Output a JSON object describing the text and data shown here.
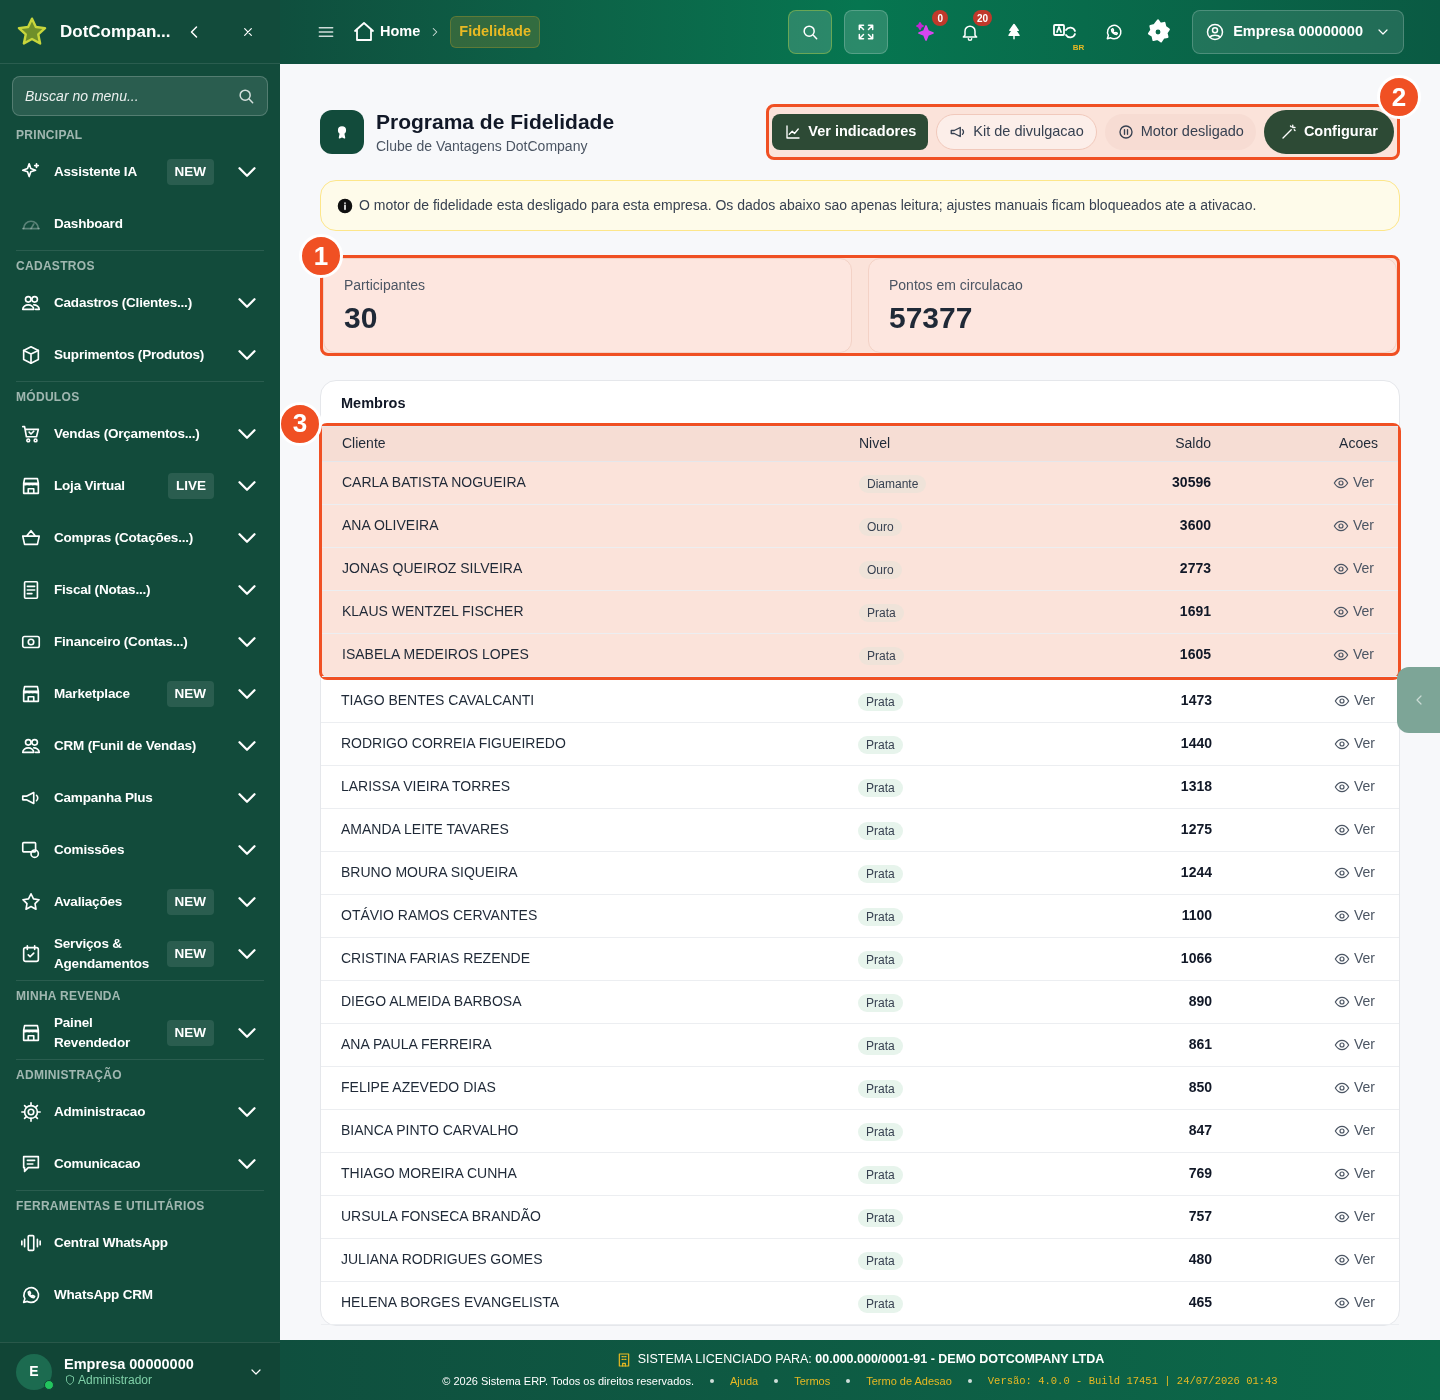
{
  "sidebar": {
    "brand": "DotCompan...",
    "search": {
      "placeholder": "Buscar no menu..."
    },
    "sections": [
      {
        "title": "PRINCIPAL",
        "items": [
          {
            "label": "Assistente IA",
            "badge": "NEW",
            "expandable": true
          },
          {
            "label": "Dashboard",
            "expandable": false
          }
        ]
      },
      {
        "title": "CADASTROS",
        "items": [
          {
            "label": "Cadastros (Clientes...)",
            "expandable": true
          },
          {
            "label": "Suprimentos (Produtos)",
            "expandable": true
          }
        ]
      },
      {
        "title": "MÓDULOS",
        "items": [
          {
            "label": "Vendas (Orçamentos...)",
            "expandable": true
          },
          {
            "label": "Loja Virtual",
            "badge": "LIVE",
            "expandable": true
          },
          {
            "label": "Compras (Cotações...)",
            "expandable": true
          },
          {
            "label": "Fiscal (Notas...)",
            "expandable": true
          },
          {
            "label": "Financeiro (Contas...)",
            "expandable": true
          },
          {
            "label": "Marketplace",
            "badge": "NEW",
            "expandable": true
          },
          {
            "label": "CRM (Funil de Vendas)",
            "expandable": true
          },
          {
            "label": "Campanha Plus",
            "expandable": true
          },
          {
            "label": "Comissões",
            "expandable": true
          },
          {
            "label": "Avaliações",
            "badge": "NEW",
            "expandable": true
          },
          {
            "label": "Serviços & Agendamentos",
            "badge": "NEW",
            "expandable": true
          }
        ]
      },
      {
        "title": "MINHA REVENDA",
        "items": [
          {
            "label": "Painel Revendedor",
            "badge": "NEW",
            "expandable": true
          }
        ]
      },
      {
        "title": "ADMINISTRAÇÃO",
        "items": [
          {
            "label": "Administracao",
            "expandable": true
          },
          {
            "label": "Comunicacao",
            "expandable": true
          }
        ]
      },
      {
        "title": "FERRAMENTAS E UTILITÁRIOS",
        "items": [
          {
            "label": "Central WhatsApp",
            "expandable": false
          },
          {
            "label": "WhatsApp CRM",
            "expandable": false
          }
        ]
      }
    ],
    "user": {
      "initial": "E",
      "name": "Empresa 00000000",
      "role": "Administrador",
      "online": true
    }
  },
  "topbar": {
    "breadcrumb": [
      {
        "label": "Home",
        "current": false
      },
      {
        "label": "Fidelidade",
        "current": true
      }
    ],
    "ai_count": "0",
    "notification_count": "20",
    "language": "BR",
    "account": "Empresa 00000000"
  },
  "header": {
    "title": "Programa de Fidelidade",
    "subtitle": "Clube de Vantagens DotCompany",
    "actions": [
      {
        "label": "Ver indicadores",
        "kind": "primary"
      },
      {
        "label": "Kit de divulgacao",
        "kind": "outline"
      },
      {
        "label": "Motor desligado",
        "kind": "status"
      },
      {
        "label": "Configurar",
        "kind": "main"
      }
    ]
  },
  "alert": "O motor de fidelidade esta desligado para esta empresa. Os dados abaixo sao apenas leitura; ajustes manuais ficam bloqueados ate a ativacao.",
  "stats": [
    {
      "label": "Participantes",
      "value": "30"
    },
    {
      "label": "Pontos em circulacao",
      "value": "57377"
    }
  ],
  "members": {
    "title": "Membros",
    "columns": [
      "Cliente",
      "Nivel",
      "Saldo",
      "Acoes"
    ],
    "rows": [
      {
        "name": "CARLA BATISTA NOGUEIRA",
        "level": "Diamante",
        "balance": "30596",
        "action": "Ver",
        "highlighted": true
      },
      {
        "name": "ANA OLIVEIRA",
        "level": "Ouro",
        "balance": "3600",
        "action": "Ver",
        "highlighted": true
      },
      {
        "name": "JONAS QUEIROZ SILVEIRA",
        "level": "Ouro",
        "balance": "2773",
        "action": "Ver",
        "highlighted": true
      },
      {
        "name": "KLAUS WENTZEL FISCHER",
        "level": "Prata",
        "balance": "1691",
        "action": "Ver",
        "highlighted": true
      },
      {
        "name": "ISABELA MEDEIROS LOPES",
        "level": "Prata",
        "balance": "1605",
        "action": "Ver",
        "highlighted": true
      },
      {
        "name": "TIAGO BENTES CAVALCANTI",
        "level": "Prata",
        "balance": "1473",
        "action": "Ver",
        "highlighted": false
      },
      {
        "name": "RODRIGO CORREIA FIGUEIREDO",
        "level": "Prata",
        "balance": "1440",
        "action": "Ver",
        "highlighted": false
      },
      {
        "name": "LARISSA VIEIRA TORRES",
        "level": "Prata",
        "balance": "1318",
        "action": "Ver",
        "highlighted": false
      },
      {
        "name": "AMANDA LEITE TAVARES",
        "level": "Prata",
        "balance": "1275",
        "action": "Ver",
        "highlighted": false
      },
      {
        "name": "BRUNO MOURA SIQUEIRA",
        "level": "Prata",
        "balance": "1244",
        "action": "Ver",
        "highlighted": false
      },
      {
        "name": "OTÁVIO RAMOS CERVANTES",
        "level": "Prata",
        "balance": "1100",
        "action": "Ver",
        "highlighted": false
      },
      {
        "name": "CRISTINA FARIAS REZENDE",
        "level": "Prata",
        "balance": "1066",
        "action": "Ver",
        "highlighted": false
      },
      {
        "name": "DIEGO ALMEIDA BARBOSA",
        "level": "Prata",
        "balance": "890",
        "action": "Ver",
        "highlighted": false
      },
      {
        "name": "ANA PAULA FERREIRA",
        "level": "Prata",
        "balance": "861",
        "action": "Ver",
        "highlighted": false
      },
      {
        "name": "FELIPE AZEVEDO DIAS",
        "level": "Prata",
        "balance": "850",
        "action": "Ver",
        "highlighted": false
      },
      {
        "name": "BIANCA PINTO CARVALHO",
        "level": "Prata",
        "balance": "847",
        "action": "Ver",
        "highlighted": false
      },
      {
        "name": "THIAGO MOREIRA CUNHA",
        "level": "Prata",
        "balance": "769",
        "action": "Ver",
        "highlighted": false
      },
      {
        "name": "URSULA FONSECA BRANDÃO",
        "level": "Prata",
        "balance": "757",
        "action": "Ver",
        "highlighted": false
      },
      {
        "name": "JULIANA RODRIGUES GOMES",
        "level": "Prata",
        "balance": "480",
        "action": "Ver",
        "highlighted": false
      },
      {
        "name": "HELENA BORGES EVANGELISTA",
        "level": "Prata",
        "balance": "465",
        "action": "Ver",
        "highlighted": false
      }
    ]
  },
  "footer": {
    "license": "SISTEMA LICENCIADO PARA: **00.000.000/0001-91 - DEMO DOTCOMPANY LTDA**",
    "copyright": "© 2026 Sistema ERP. Todos os direitos reservados.",
    "links": [
      "Ajuda",
      "Termos",
      "Termo de Adesao"
    ],
    "version": "Versão: 4.0.0 - Build 17451 | 24/07/2026 01:43"
  },
  "annotations": [
    {
      "number": "1",
      "kind": "stats"
    },
    {
      "number": "2",
      "kind": "actions"
    },
    {
      "number": "3",
      "kind": "members"
    }
  ]
}
